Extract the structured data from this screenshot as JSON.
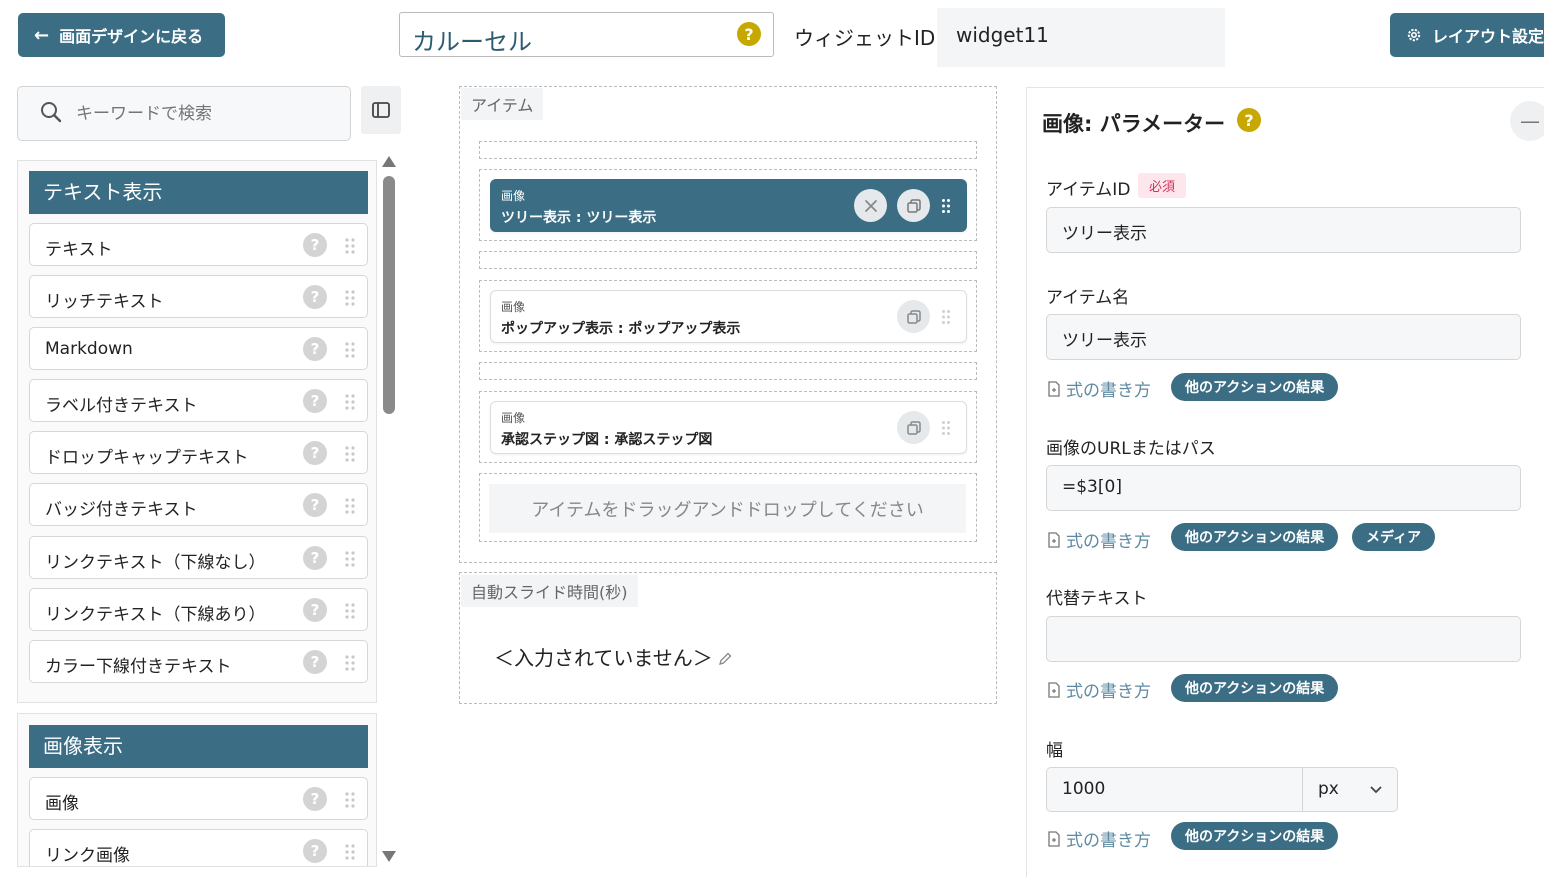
{
  "topbar": {
    "back_label": "画面デザインに戻る",
    "widget_title": "カルーセル",
    "help_glyph": "?",
    "widget_id_label": "ウィジェットID",
    "widget_id_value": "widget11",
    "layout_label": "レイアウト設定"
  },
  "palette": {
    "search_placeholder": "キーワードで検索",
    "help_glyph": "?",
    "sections": [
      {
        "title": "テキスト表示",
        "items": [
          "テキスト",
          "リッチテキスト",
          "Markdown",
          "ラベル付きテキスト",
          "ドロップキャップテキスト",
          "バッジ付きテキスト",
          "リンクテキスト（下線なし）",
          "リンクテキスト（下線あり）",
          "カラー下線付きテキスト"
        ]
      },
      {
        "title": "画像表示",
        "items": [
          "画像",
          "リンク画像"
        ]
      }
    ]
  },
  "canvas": {
    "items_tab": "アイテム",
    "items": [
      {
        "type": "画像",
        "name": "ツリー表示 : ツリー表示",
        "selected": true
      },
      {
        "type": "画像",
        "name": "ポップアップ表示 : ポップアップ表示",
        "selected": false
      },
      {
        "type": "画像",
        "name": "承認ステップ図 : 承認ステップ図",
        "selected": false
      }
    ],
    "drop_hint": "アイテムをドラッグアンドドロップしてください",
    "auto_slide_tab": "自動スライド時間(秒)",
    "auto_slide_value": "＜入力されていません＞"
  },
  "params": {
    "title": "画像: パラメーター",
    "help_glyph": "?",
    "collapse_glyph": "—",
    "item_id_label": "アイテムID",
    "required_badge": "必須",
    "item_id_value": "ツリー表示",
    "item_name_label": "アイテム名",
    "item_name_value": "ツリー表示",
    "formula_link": "式の書き方",
    "chip_other_action": "他のアクションの結果",
    "chip_media": "メディア",
    "url_label": "画像のURLまたはパス",
    "url_value": "=$3[0]",
    "alt_label": "代替テキスト",
    "alt_value": "",
    "width_label": "幅",
    "width_value": "1000",
    "width_unit": "px"
  },
  "colors": {
    "primary": "#3b6e85",
    "help_yellow": "#c7a800",
    "required_red": "#d0325a"
  }
}
